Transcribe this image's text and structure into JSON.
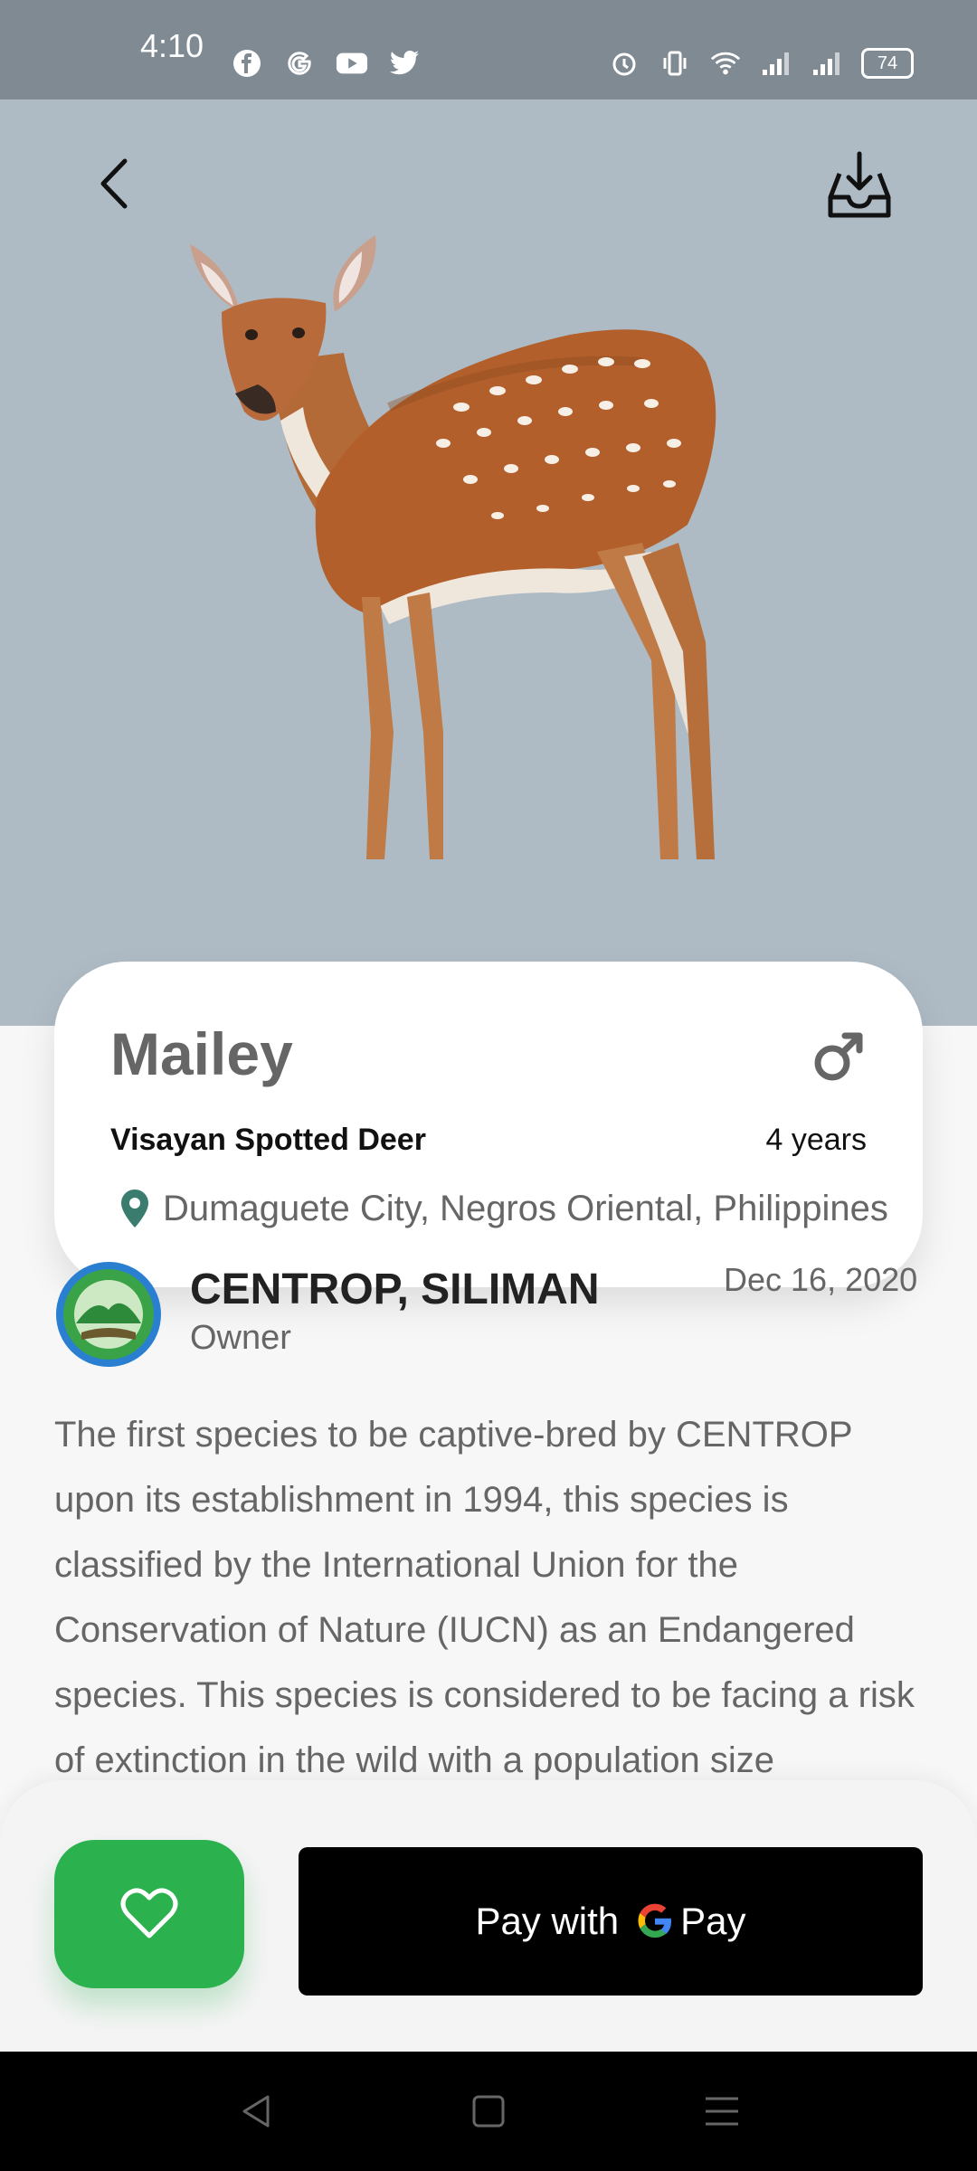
{
  "status_bar": {
    "time": "4:10",
    "left_icons": [
      "facebook-icon",
      "google-icon",
      "youtube-icon",
      "twitter-icon"
    ],
    "right_icons": [
      "alarm-icon",
      "vibrate-icon",
      "wifi-icon",
      "signal-icon",
      "signal-icon"
    ],
    "battery": "74"
  },
  "header": {
    "back_icon": "chevron-left-icon",
    "download_icon": "download-tray-icon",
    "hero_bg": "#aebbc4"
  },
  "animal": {
    "name": "Mailey",
    "sex_icon": "male-symbol-icon",
    "species": "Visayan Spotted Deer",
    "age": "4 years",
    "location": "Dumaguete City, Negros Oriental, Philippines"
  },
  "owner": {
    "name": "CENTROP, SILIMAN",
    "role": "Owner",
    "date": "Dec 16, 2020"
  },
  "description": "The first species to be captive-bred by CENTROP upon its establishment in 1994, this species is classified by the International Union for the Conservation of Nature (IUCN) as an Endangered species.  This species is considered to be facing a risk of extinction in the wild with a population size",
  "actions": {
    "favorite_icon": "heart-icon",
    "pay_label": "Pay with",
    "pay_brand": "Pay",
    "favorite_color": "#2bb14e"
  },
  "nav": {
    "icons": [
      "nav-back-icon",
      "nav-home-icon",
      "nav-menu-icon"
    ]
  }
}
